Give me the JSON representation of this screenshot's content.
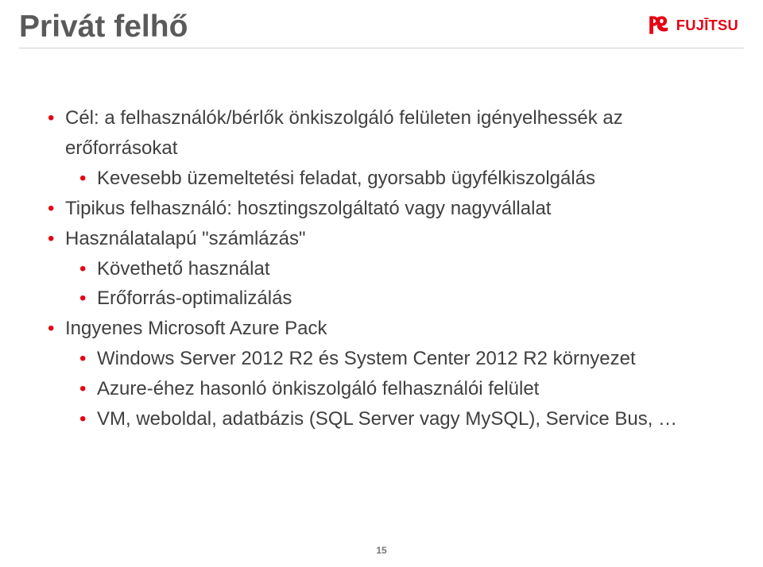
{
  "title": "Privát felhő",
  "logo": {
    "name": "fujitsu-logo",
    "text": "FUJITSU",
    "color": "#e60012"
  },
  "bullets": [
    {
      "level": 1,
      "text": "Cél: a felhasználók/bérlők önkiszolgáló felületen igényelhessék az erőforrásokat"
    },
    {
      "level": 2,
      "text": "Kevesebb üzemeltetési feladat, gyorsabb ügyfélkiszolgálás"
    },
    {
      "level": 1,
      "text": "Tipikus felhasználó: hosztingszolgáltató vagy nagyvállalat"
    },
    {
      "level": 1,
      "text": "Használatalapú \"számlázás\""
    },
    {
      "level": 2,
      "text": "Követhető használat"
    },
    {
      "level": 2,
      "text": "Erőforrás-optimalizálás"
    },
    {
      "level": 1,
      "text": "Ingyenes Microsoft Azure Pack"
    },
    {
      "level": 2,
      "text": "Windows Server 2012 R2 és System Center 2012 R2 környezet"
    },
    {
      "level": 2,
      "text": "Azure-éhez hasonló önkiszolgáló felhasználói felület"
    },
    {
      "level": 2,
      "text": "VM, weboldal, adatbázis (SQL Server vagy MySQL), Service Bus, …"
    }
  ],
  "page_number": "15"
}
